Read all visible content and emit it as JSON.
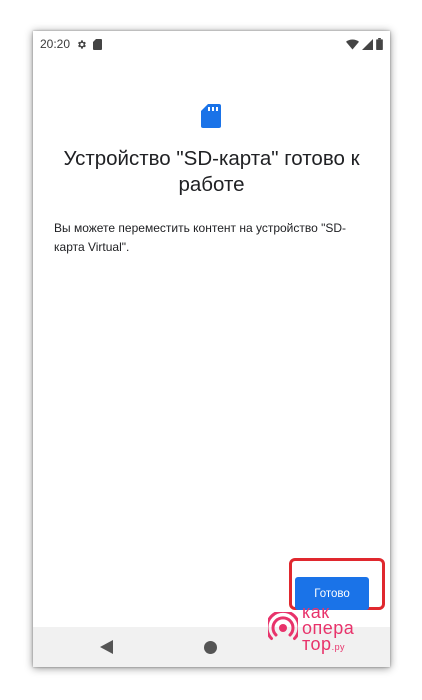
{
  "status_bar": {
    "time": "20:20",
    "left_icons": [
      "settings-icon",
      "sd-card-icon"
    ],
    "right_icons": [
      "wifi-icon",
      "signal-icon",
      "battery-icon"
    ]
  },
  "dialog": {
    "icon": "sd-card-icon",
    "title": "Устройство \"SD-карта\" готово к работе",
    "body": "Вы можете переместить контент на устройство \"SD-карта Virtual\"."
  },
  "actions": {
    "done_label": "Готово"
  },
  "nav_bar": {
    "icons": [
      "back-icon",
      "home-icon"
    ]
  },
  "watermark": {
    "line1": "как",
    "line2": "опера",
    "line3": "тор",
    "suffix": ".ру"
  },
  "colors": {
    "accent": "#1a73e8",
    "highlight": "#e0282e",
    "watermark": "#e8336b",
    "navbar": "#f1f1f1"
  }
}
